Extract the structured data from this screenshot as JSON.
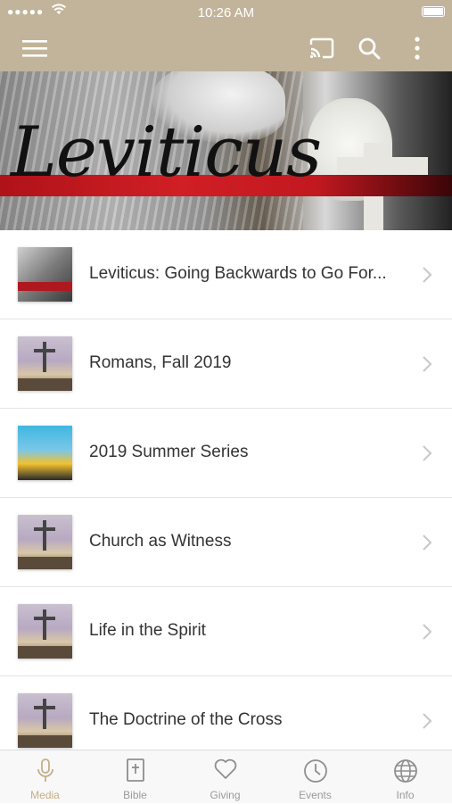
{
  "status_bar": {
    "signal": "●●●●●",
    "time": "10:26 AM"
  },
  "toolbar": {
    "menu_icon": "hamburger-icon",
    "cast_icon": "cast-icon",
    "search_icon": "search-icon",
    "more_icon": "more-vertical-icon",
    "background_color": "#c2b49a"
  },
  "banner": {
    "title": "Leviticus"
  },
  "series": [
    {
      "title": "Leviticus: Going Backwards to Go For...",
      "thumb": "lev"
    },
    {
      "title": "Romans, Fall 2019",
      "thumb": "rom"
    },
    {
      "title": "2019 Summer Series",
      "thumb": "sum"
    },
    {
      "title": "Church as Witness",
      "thumb": "rom"
    },
    {
      "title": "Life in the Spirit",
      "thumb": "rom"
    },
    {
      "title": "The Doctrine of the Cross",
      "thumb": "rom"
    }
  ],
  "tabs": [
    {
      "label": "Media",
      "icon": "microphone-icon",
      "active": true
    },
    {
      "label": "Bible",
      "icon": "bible-icon",
      "active": false
    },
    {
      "label": "Giving",
      "icon": "heart-icon",
      "active": false
    },
    {
      "label": "Events",
      "icon": "clock-icon",
      "active": false
    },
    {
      "label": "Info",
      "icon": "globe-icon",
      "active": false
    }
  ],
  "colors": {
    "accent": "#c4ae86",
    "inactive": "#9a9a9a",
    "text": "#333333"
  }
}
